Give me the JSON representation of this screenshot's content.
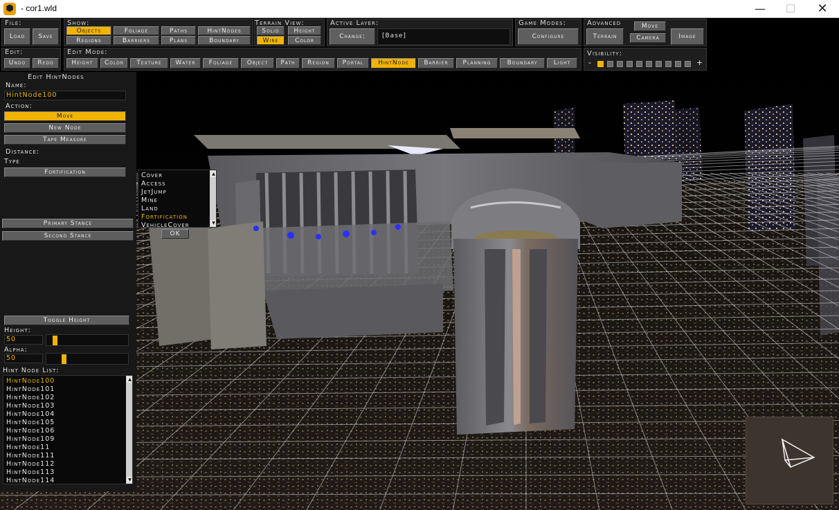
{
  "window": {
    "title": "- cor1.wld",
    "min": "—",
    "max": "☐",
    "close": "✕"
  },
  "file": {
    "label": "File:",
    "load": "Load",
    "save": "Save"
  },
  "show": {
    "label": "Show:",
    "row1": [
      "Objects",
      "Foliage",
      "Paths",
      "HintNodes"
    ],
    "row2": [
      "Regions",
      "Barriers",
      "Plans",
      "Boundary"
    ],
    "active": "Objects"
  },
  "terrain_view": {
    "label": "Terrain View:",
    "solid": "Solid",
    "height": "Height",
    "wire": "Wire",
    "color": "Color",
    "active": "Wire"
  },
  "active_layer": {
    "label": "Active Layer:",
    "change": "Change:",
    "value": "[Base]"
  },
  "game_modes": {
    "label": "Game Modes:",
    "configure": "Configure"
  },
  "advanced": {
    "label": "Advanced",
    "terrain": "Terrain",
    "move": "Move",
    "camera": "Camera",
    "image": "Image"
  },
  "edit": {
    "label": "Edit:",
    "undo": "Undo",
    "redo": "Redo"
  },
  "edit_mode": {
    "label": "Edit Mode:",
    "items": [
      "Height",
      "Color",
      "Texture",
      "Water",
      "Foliage",
      "Object",
      "Path",
      "Region",
      "Portal",
      "HintNode",
      "Barrier",
      "Planning",
      "Boundary",
      "Light"
    ],
    "active": "HintNode"
  },
  "visibility": {
    "label": "Visibility:",
    "minus": "-",
    "plus": "+",
    "squares": 10,
    "active_index": 0
  },
  "edit_hintnodes": {
    "title": "Edit HintNodes",
    "name_label": "Name:",
    "name_value": "HintNode100",
    "action_label": "Action:",
    "move": "Move",
    "new_node": "New Node",
    "tape_measure": "Tape Measure",
    "distance_label": "Distance:",
    "type_label": "Type",
    "type_value": "Fortification",
    "primary_stance": "Primary Stance",
    "second_stance": "Second Stance",
    "toggle_height": "Toggle Height",
    "height_label": "Height:",
    "height_value": "50",
    "alpha_label": "Alpha:",
    "alpha_value": "50",
    "height_level": 0.08,
    "alpha_level": 0.2,
    "list_label": "Hint Node List:",
    "nodes": [
      "HintNode100",
      "HintNode101",
      "HintNode102",
      "HintNode103",
      "HintNode104",
      "HintNode105",
      "HintNode106",
      "HintNode109",
      "HintNode11",
      "HintNode111",
      "HintNode112",
      "HintNode113",
      "HintNode114"
    ],
    "selected_node": "HintNode100"
  },
  "type_dropdown": {
    "options": [
      "Cover",
      "Access",
      "JetJump",
      "Mine",
      "Land",
      "Fortification",
      "VehicleCover"
    ],
    "selected": "Fortification",
    "ok": "OK"
  },
  "colors": {
    "accent": "#f0b400",
    "panel": "#1e1e1e",
    "button": "#5e5e5e",
    "grid": "#dcdcdc"
  }
}
